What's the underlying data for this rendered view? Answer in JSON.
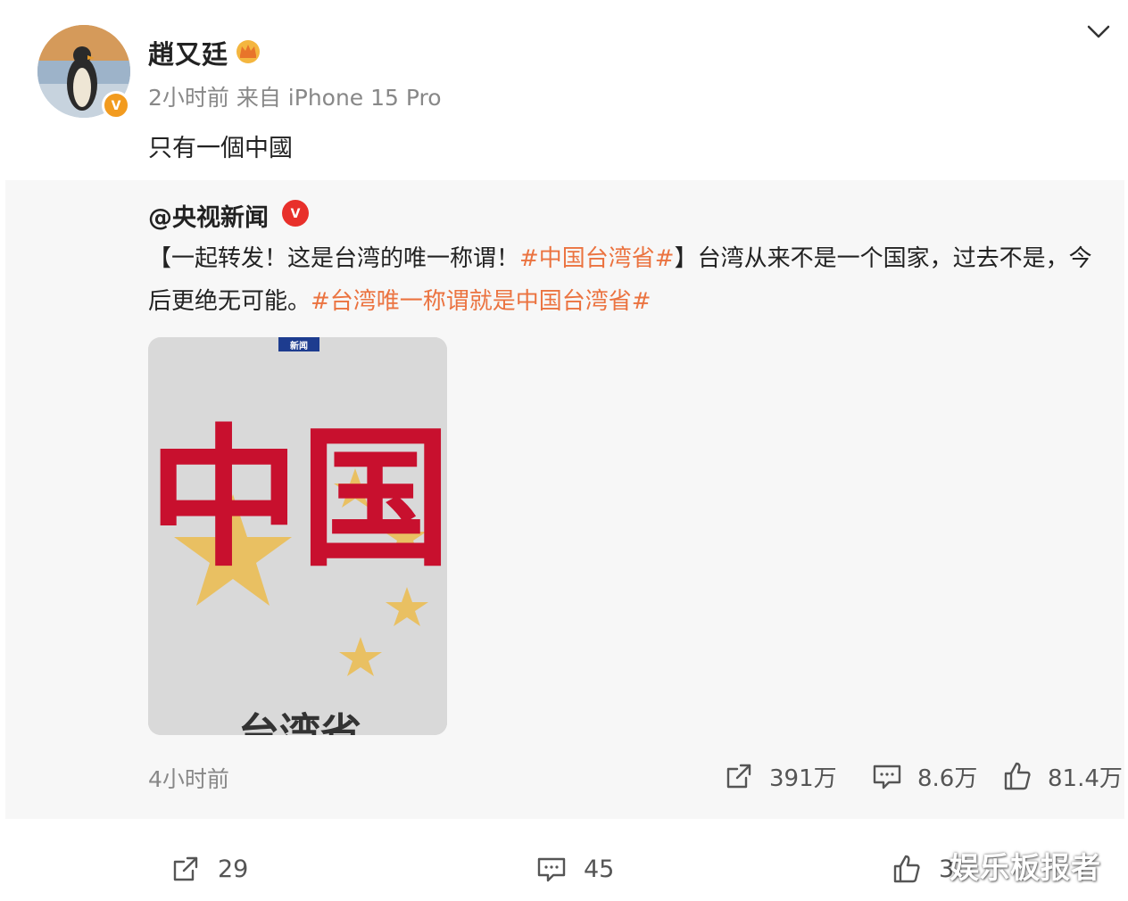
{
  "post": {
    "author": "趙又廷",
    "meta": "2小时前  来自 iPhone 15 Pro",
    "text": "只有一個中國"
  },
  "repost": {
    "author": "@央视新闻",
    "body_part1": "【一起转发！这是台湾的唯一称谓！",
    "hashtag1": "#中国台湾省#",
    "body_part2": "】台湾从来不是一个国家，过去不是，今后更绝无可能。",
    "hashtag2": "#台湾唯一称谓就是中国台湾省#",
    "image": {
      "badge_text": "新闻",
      "headline": "中国",
      "caption": "台湾省"
    },
    "time": "4小时前",
    "actions": {
      "share_count": "391万",
      "comment_count": "8.6万",
      "like_count": "81.4万"
    }
  },
  "toolbar": {
    "share_count": "29",
    "comment_count": "45",
    "like_count": "3"
  },
  "watermark": "娱乐板报者",
  "colors": {
    "hashtag": "#eb7340",
    "verified_orange": "#f29b1f",
    "verified_red": "#e8302b",
    "repost_bg": "#f7f7f7"
  },
  "icons": [
    "chevron-down-icon",
    "crown-icon",
    "verified-icon",
    "share-icon",
    "comment-icon",
    "like-icon"
  ]
}
